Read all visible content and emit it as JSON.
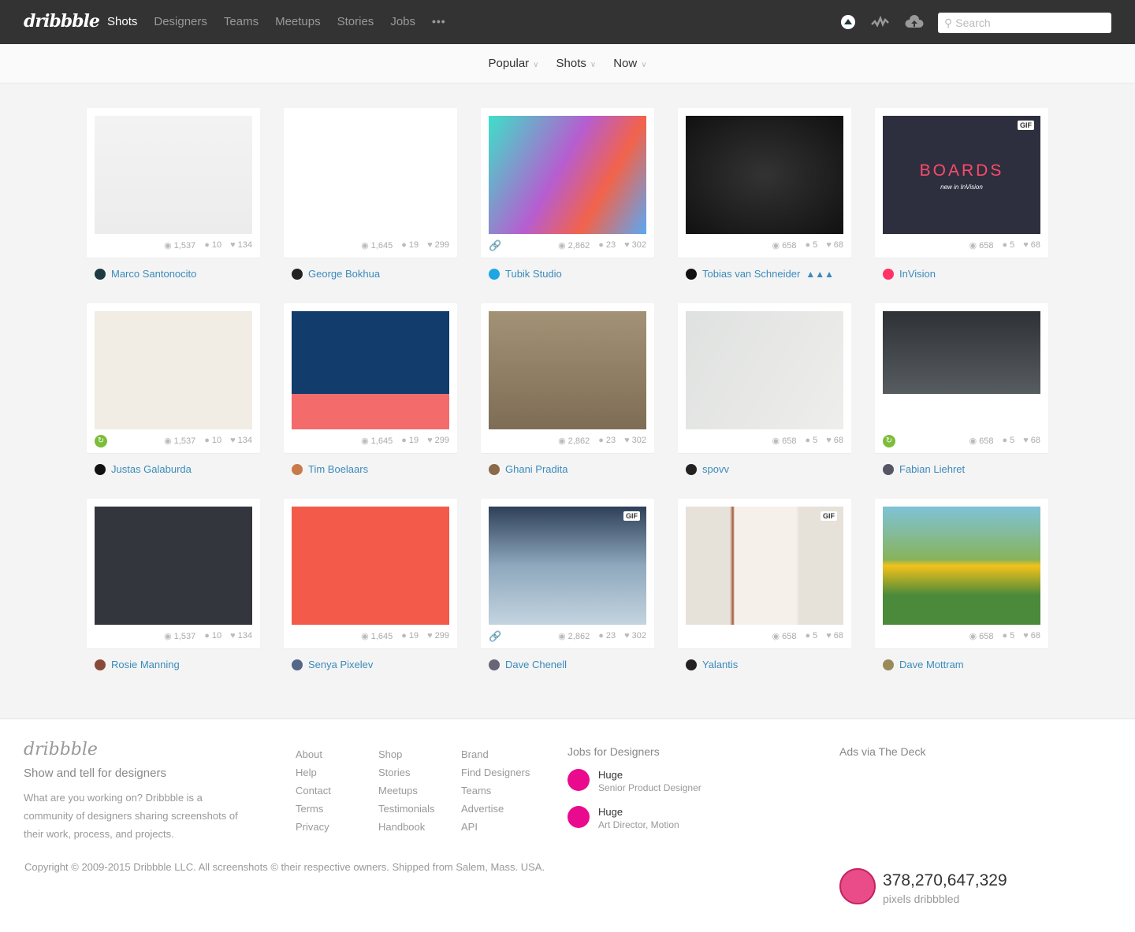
{
  "header": {
    "logo": "dribbble",
    "nav": [
      "Shots",
      "Designers",
      "Teams",
      "Meetups",
      "Stories",
      "Jobs"
    ],
    "more": "•••",
    "search_placeholder": "Search",
    "icons": [
      "user-avatar-icon",
      "activity-icon",
      "upload-cloud-icon"
    ]
  },
  "filters": [
    {
      "label": "Popular"
    },
    {
      "label": "Shots"
    },
    {
      "label": "Now"
    }
  ],
  "shots": [
    {
      "author": "Marco Santonocito",
      "views": "1,537",
      "comments": "10",
      "likes": "134",
      "bg": "linear-gradient(#f3f3f3,#ececec)",
      "avatar": "#1d3a40"
    },
    {
      "author": "George Bokhua",
      "views": "1,645",
      "comments": "19",
      "likes": "299",
      "bg": "#ffffff",
      "avatar": "#222"
    },
    {
      "author": "Tubik Studio",
      "views": "2,862",
      "comments": "23",
      "likes": "302",
      "bg": "linear-gradient(120deg,#3de0c8,#b65dd0 45%,#f2634a 70%,#5aa8f5)",
      "avatar": "#1ea6e4",
      "link": true
    },
    {
      "author": "Tobias van Schneider",
      "badge": "▲▲▲",
      "views": "658",
      "comments": "5",
      "likes": "68",
      "bg": "radial-gradient(#333,#111)",
      "avatar": "#111"
    },
    {
      "author": "InVision",
      "views": "658",
      "comments": "5",
      "likes": "68",
      "bg": "#2e2f3e",
      "avatar": "#ff3366",
      "gif": "GIF",
      "title": "BOARDS",
      "subtitle": "new in InVision"
    },
    {
      "author": "Justas Galaburda",
      "views": "1,537",
      "comments": "10",
      "likes": "134",
      "bg": "#f1ede4",
      "avatar": "#111",
      "rebound": true
    },
    {
      "author": "Tim Boelaars",
      "views": "1,645",
      "comments": "19",
      "likes": "299",
      "bg": "linear-gradient(#113c6b 70%,#f36b6b 70%)",
      "avatar": "#c87a4a"
    },
    {
      "author": "Ghani Pradita",
      "views": "2,862",
      "comments": "23",
      "likes": "302",
      "bg": "linear-gradient(#a39276,#7e6d55)",
      "avatar": "#8a6a4a"
    },
    {
      "author": "spovv",
      "views": "658",
      "comments": "5",
      "likes": "68",
      "bg": "linear-gradient(120deg,#dfe1e0,#eeeeec)",
      "avatar": "#222"
    },
    {
      "author": "Fabian Liehret",
      "views": "658",
      "comments": "5",
      "likes": "68",
      "bg": "linear-gradient(#2e3236,#575c60 70%,#fff 70%)",
      "avatar": "#556",
      "rebound": true
    },
    {
      "author": "Rosie Manning",
      "views": "1,537",
      "comments": "10",
      "likes": "134",
      "bg": "#33373d",
      "avatar": "#8a4a3a"
    },
    {
      "author": "Senya Pixelev",
      "views": "1,645",
      "comments": "19",
      "likes": "299",
      "bg": "#f35a4a",
      "avatar": "#556688"
    },
    {
      "author": "Dave Chenell",
      "views": "2,862",
      "comments": "23",
      "likes": "302",
      "bg": "linear-gradient(#2e4058,#8ea8bd 50%,#c4d4e0)",
      "avatar": "#667",
      "gif": "GIF",
      "link": true
    },
    {
      "author": "Yalantis",
      "views": "658",
      "comments": "5",
      "likes": "68",
      "bg": "linear-gradient(90deg,#e6e2da 28%,#a35a3a 30%,#f5f1ea 31%,#f5f1ea 70%,#e6e2da 72%)",
      "avatar": "#222",
      "gif": "GIF"
    },
    {
      "author": "Dave Mottram",
      "views": "658",
      "comments": "5",
      "likes": "68",
      "bg": "linear-gradient(#7fc3d8,#88b35a 45%,#f4c21a 50%,#4a8a3a 75%)",
      "avatar": "#9a8a5a"
    }
  ],
  "footer": {
    "logo": "dribbble",
    "tagline": "Show and tell for designers",
    "description": "What are you working on? Dribbble is a community of designers sharing screenshots of their work, process, and projects.",
    "col1": [
      "About",
      "Help",
      "Contact",
      "Terms",
      "Privacy"
    ],
    "col2": [
      "Shop",
      "Stories",
      "Meetups",
      "Testimonials",
      "Handbook"
    ],
    "col3": [
      "Brand",
      "Find Designers",
      "Teams",
      "Advertise",
      "API"
    ],
    "jobs_title": "Jobs for Designers",
    "jobs": [
      {
        "company": "Huge",
        "role": "Senior Product Designer"
      },
      {
        "company": "Huge",
        "role": "Art Director, Motion"
      }
    ],
    "ads": "Ads via The Deck",
    "copyright": "Copyright © 2009-2015 Dribbble LLC. All screenshots © their respective owners. Shipped from Salem, Mass. USA.",
    "pixels": "378,270,647,329",
    "pixels_label": "pixels dribbbled"
  }
}
